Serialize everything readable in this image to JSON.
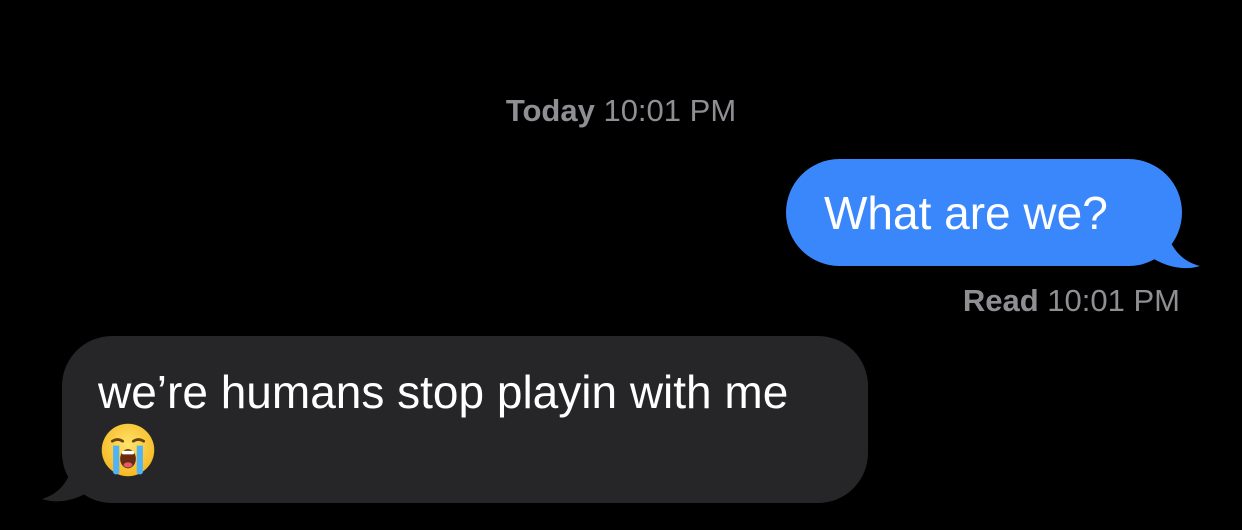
{
  "conversation": {
    "timestamp": {
      "day": "Today",
      "time": "10:01 PM"
    },
    "messages": [
      {
        "direction": "outgoing",
        "text": "What are we?"
      },
      {
        "direction": "incoming",
        "text": "we’re humans stop playin with me"
      }
    ],
    "read_receipt": {
      "status": "Read",
      "time": "10:01 PM"
    }
  },
  "emoji": {
    "name": "loudly-crying-face-icon"
  },
  "colors": {
    "background": "#000000",
    "outgoing_bubble": "#3a87fc",
    "incoming_bubble": "#262628",
    "meta_text": "#8e8e93",
    "message_text": "#ffffff"
  }
}
